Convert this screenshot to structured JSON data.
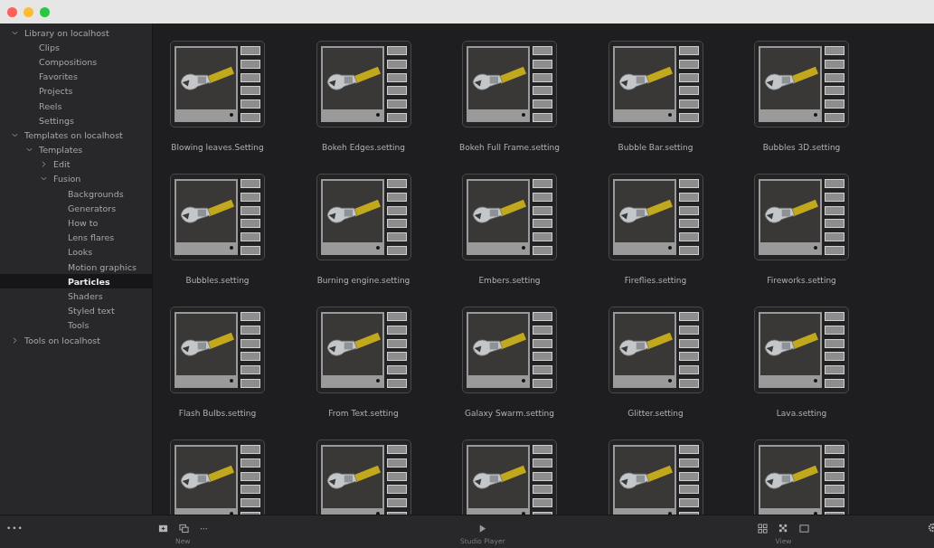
{
  "sidebar": {
    "tree": [
      {
        "label": "Library on localhost",
        "expanded": true,
        "selected": false,
        "children": [
          {
            "label": "Clips",
            "selected": false
          },
          {
            "label": "Compositions",
            "selected": false
          },
          {
            "label": "Favorites",
            "selected": false
          },
          {
            "label": "Projects",
            "selected": false
          },
          {
            "label": "Reels",
            "selected": false
          },
          {
            "label": "Settings",
            "selected": false
          }
        ]
      },
      {
        "label": "Templates on localhost",
        "expanded": true,
        "selected": false,
        "children": [
          {
            "label": "Templates",
            "expanded": true,
            "selected": false,
            "children": [
              {
                "label": "Edit",
                "expanded": false,
                "selected": false
              },
              {
                "label": "Fusion",
                "expanded": true,
                "selected": false,
                "children": [
                  {
                    "label": "Backgrounds",
                    "selected": false
                  },
                  {
                    "label": "Generators",
                    "selected": false
                  },
                  {
                    "label": "How to",
                    "selected": false
                  },
                  {
                    "label": "Lens flares",
                    "selected": false
                  },
                  {
                    "label": "Looks",
                    "selected": false
                  },
                  {
                    "label": "Motion graphics",
                    "selected": false
                  },
                  {
                    "label": "Particles",
                    "selected": true
                  },
                  {
                    "label": "Shaders",
                    "selected": false
                  },
                  {
                    "label": "Styled text",
                    "selected": false
                  },
                  {
                    "label": "Tools",
                    "selected": false
                  }
                ]
              }
            ]
          }
        ]
      },
      {
        "label": "Tools on localhost",
        "expanded": false,
        "selected": false
      }
    ]
  },
  "items": [
    {
      "name": "Blowing leaves.Setting"
    },
    {
      "name": "Bokeh Edges.setting"
    },
    {
      "name": "Bokeh Full Frame.setting"
    },
    {
      "name": "Bubble Bar.setting"
    },
    {
      "name": "Bubbles 3D.setting"
    },
    {
      "name": "Bubbles.setting"
    },
    {
      "name": "Burning engine.setting"
    },
    {
      "name": "Embers.setting"
    },
    {
      "name": "Fireflies.setting"
    },
    {
      "name": "Fireworks.setting"
    },
    {
      "name": "Flash Bulbs.setting"
    },
    {
      "name": "From Text.setting"
    },
    {
      "name": "Galaxy Swarm.setting"
    },
    {
      "name": "Glitter.setting"
    },
    {
      "name": "Lava.setting"
    },
    {
      "kind": "partial"
    },
    {
      "kind": "partial"
    },
    {
      "kind": "partial"
    },
    {
      "kind": "partial"
    },
    {
      "kind": "partial"
    }
  ],
  "toolbar": {
    "menu": "•••",
    "new_more": "···",
    "groups": [
      {
        "label": "New"
      },
      {
        "label": "Studio Player"
      },
      {
        "label": "View"
      }
    ]
  }
}
